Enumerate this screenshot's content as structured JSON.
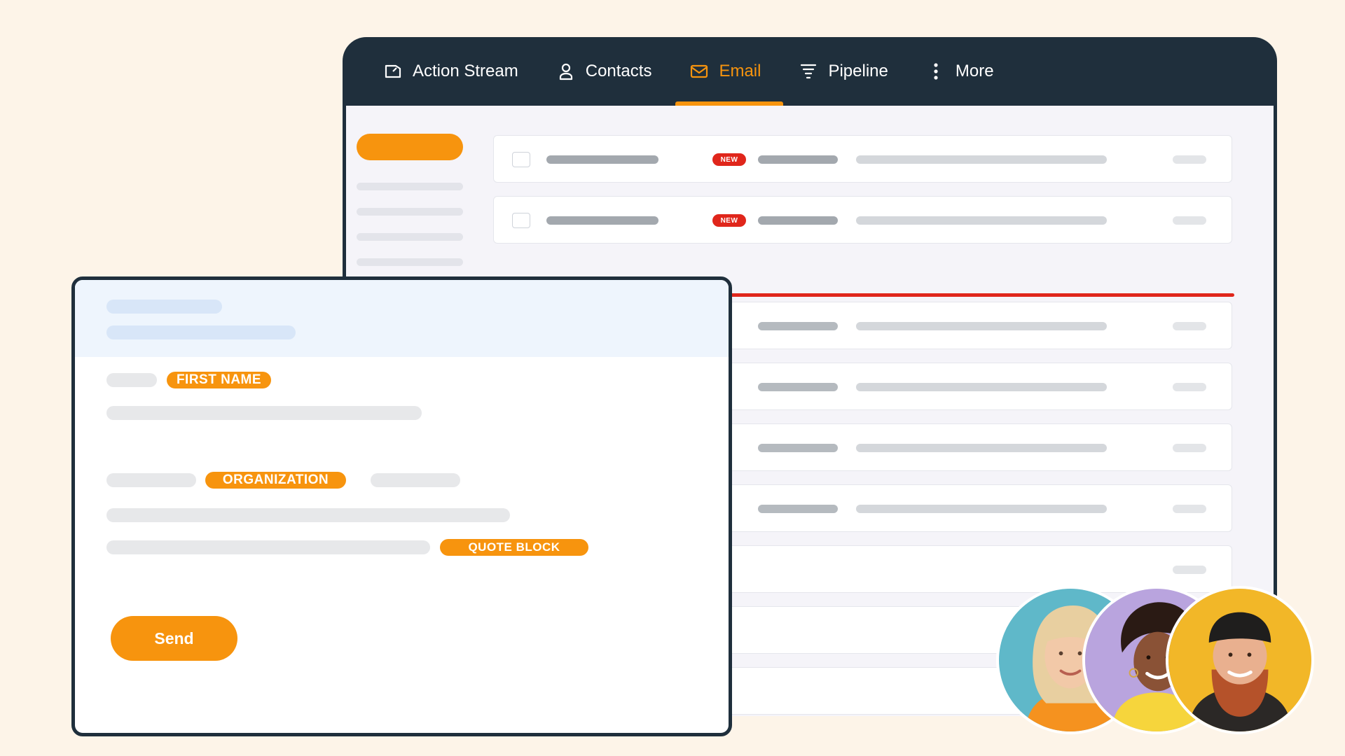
{
  "nav": {
    "tabs": [
      {
        "label": "Action Stream",
        "icon": "action-stream-icon",
        "active": false
      },
      {
        "label": "Contacts",
        "icon": "user-icon",
        "active": false
      },
      {
        "label": "Email",
        "icon": "envelope-icon",
        "active": true
      },
      {
        "label": "Pipeline",
        "icon": "funnel-icon",
        "active": false
      },
      {
        "label": "More",
        "icon": "vertical-dots-icon",
        "active": false
      }
    ]
  },
  "inbox": {
    "badge_label": "NEW"
  },
  "compose": {
    "merge_tags": {
      "first_name": "FIRST NAME",
      "organization": "ORGANIZATION",
      "quote_block": "QUOTE BLOCK"
    },
    "send_label": "Send"
  },
  "colors": {
    "accent": "#f7940e",
    "navbar": "#1f2f3c",
    "badge": "#e0261b",
    "background": "#fdf4e8"
  }
}
